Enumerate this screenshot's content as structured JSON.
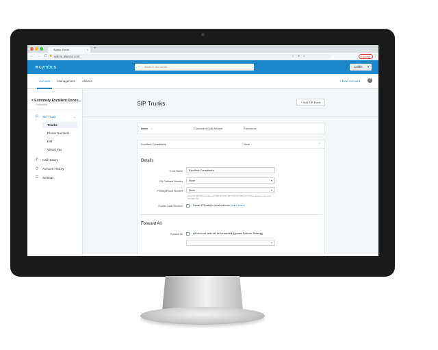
{
  "browser": {
    "tab_title": "Admin Portal",
    "tab_close": "×",
    "new_tab": "+",
    "nav_buttons": "← → C",
    "url": "admin.alianza.com",
    "lock": "🔒",
    "ext_icons": "☆ ● ◐",
    "update_label": "Update",
    "more": "⋮"
  },
  "app": {
    "logo": "≋cymbus",
    "search_placeholder": "Search accounts",
    "search_icon": "⌕",
    "user_label": "Caitlin",
    "user_caret": "▾"
  },
  "subnav": {
    "items": [
      "Account",
      "Management",
      "Alianza"
    ],
    "new_account": "+ New Account",
    "help": "?"
  },
  "sidebar": {
    "account_title": "< Extremely Excellent Consu...",
    "account_sub": "Connected",
    "sip_trunk": "SIP Trunk",
    "sip_trunk_chevron": "⌄",
    "sub_items": [
      "Trunks",
      "Phone Numbers",
      "IVR",
      "Virtual Fax"
    ],
    "call_history": "Call History",
    "account_history": "Account History",
    "settings": "Settings",
    "icons": {
      "sip_trunk": "⊟",
      "call_history": "✆",
      "account_history": "◷",
      "settings": "☷"
    }
  },
  "main": {
    "title": "SIP Trunks",
    "add_button": "+ Add SIP Trunk",
    "columns": {
      "name": "Name",
      "name_sort": "↑",
      "concurrent": "Concurrent Calls Allowed",
      "extensions": "Extensions"
    },
    "row": {
      "name": "Excellent Consultants",
      "extensions": "None",
      "chevron": "⌃"
    },
    "details": {
      "title": "Details",
      "trunk_name_label": "Trunk Name",
      "trunk_name_value": "Excellent Consultants",
      "callback_label": "911 Callback Number",
      "callback_value": "None",
      "primary_label": "Primary Phone Number",
      "primary_value": "None",
      "primary_hint": "Used for identifying outbound calls from the SIP trunk for billing and local services (not used for caller ID).",
      "local_label": "Enable Local Services",
      "local_text": "Route 911 calls to local services",
      "local_link": "(learn more)"
    },
    "forward": {
      "title": "Forward All",
      "label": "Forward All",
      "text": "All inbound calls will be forwarded (Ignores Failover Routing)",
      "select_value": ""
    }
  },
  "colors": {
    "brand": "#1c87c9",
    "bezel": "#1a1a1a"
  }
}
